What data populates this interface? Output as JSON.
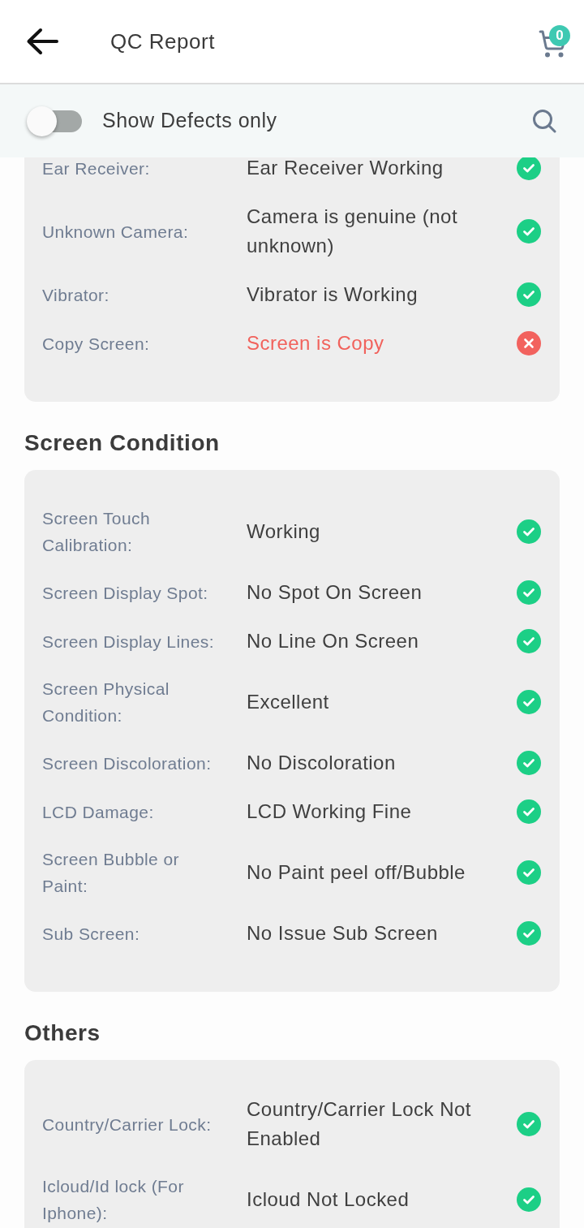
{
  "header": {
    "title": "QC Report",
    "cart_count": "0"
  },
  "filter": {
    "label": "Show Defects only",
    "on": false
  },
  "sections": [
    {
      "rows": [
        {
          "label": "Ear Receiver:",
          "value": "Ear Receiver Working",
          "passed": true
        },
        {
          "label": "Unknown Camera:",
          "value": "Camera is genuine (not unknown)",
          "passed": true
        },
        {
          "label": "Vibrator:",
          "value": "Vibrator is Working",
          "passed": true
        },
        {
          "label": "Copy Screen:",
          "value": "Screen is Copy",
          "passed": false
        }
      ]
    },
    {
      "title": "Screen Condition",
      "rows": [
        {
          "label": "Screen Touch Calibration:",
          "value": "Working",
          "passed": true
        },
        {
          "label": "Screen Display Spot:",
          "value": "No Spot On Screen",
          "passed": true
        },
        {
          "label": "Screen Display Lines:",
          "value": "No Line On Screen",
          "passed": true
        },
        {
          "label": "Screen Physical Condition:",
          "value": "Excellent",
          "passed": true
        },
        {
          "label": "Screen Discoloration:",
          "value": "No Discoloration",
          "passed": true
        },
        {
          "label": "LCD Damage:",
          "value": "LCD Working Fine",
          "passed": true
        },
        {
          "label": "Screen Bubble or Paint:",
          "value": "No Paint peel off/Bubble",
          "passed": true
        },
        {
          "label": "Sub Screen:",
          "value": "No Issue Sub Screen",
          "passed": true
        }
      ]
    },
    {
      "title": "Others",
      "rows": [
        {
          "label": "Country/Carrier Lock:",
          "value": "Country/Carrier Lock Not Enabled",
          "passed": true
        },
        {
          "label": "Icloud/Id lock (For Iphone):",
          "value": "Icloud Not Locked",
          "passed": true
        }
      ]
    }
  ]
}
